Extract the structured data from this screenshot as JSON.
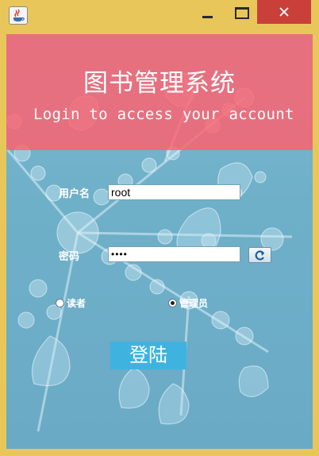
{
  "window": {
    "app_icon": "java-cup-icon",
    "minimize_icon": "minimize-icon",
    "maximize_icon": "maximize-icon",
    "close_icon": "close-icon",
    "close_color": "#c9403a",
    "frame_color": "#e8c65a"
  },
  "header": {
    "title": "图书管理系统",
    "subtitle": "Login to access your account",
    "band_color": "#ff606e"
  },
  "form": {
    "username_label": "用户名",
    "username_value": "root",
    "password_label": "密码",
    "password_value": "••••",
    "show_password_icon": "refresh-eye-icon",
    "roles": [
      {
        "label": "读者",
        "checked": false
      },
      {
        "label": "管理员",
        "checked": true
      }
    ],
    "login_label": "登陆",
    "login_color": "#3fb3e0"
  }
}
